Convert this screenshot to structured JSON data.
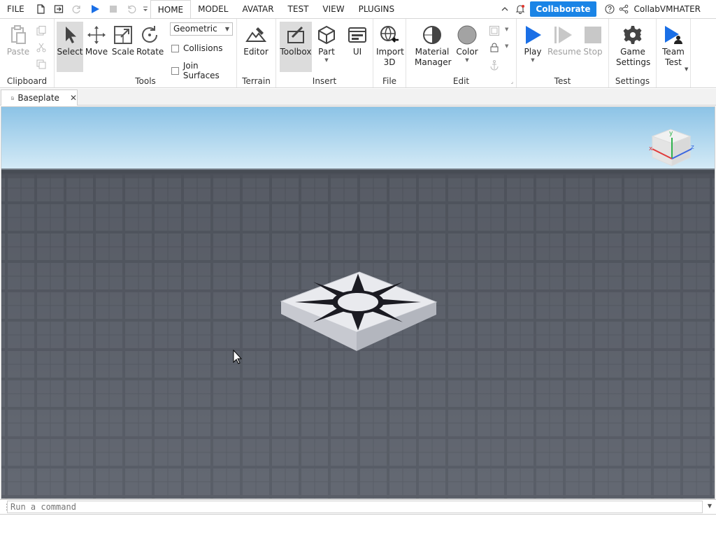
{
  "menubar": {
    "menus": [
      "FILE",
      "HOME",
      "MODEL",
      "AVATAR",
      "TEST",
      "VIEW",
      "PLUGINS"
    ],
    "active_menu": "HOME",
    "collaborate_label": "Collaborate",
    "username": "CollabVMHATER"
  },
  "ribbon": {
    "clipboard": {
      "paste_label": "Paste",
      "group_label": "Clipboard"
    },
    "tools": {
      "select_label": "Select",
      "move_label": "Move",
      "scale_label": "Scale",
      "rotate_label": "Rotate",
      "mode_value": "Geometric",
      "collisions_label": "Collisions",
      "join_surfaces_label": "Join Surfaces",
      "group_label": "Tools"
    },
    "terrain": {
      "editor_label": "Editor",
      "group_label": "Terrain"
    },
    "insert": {
      "toolbox_label": "Toolbox",
      "part_label": "Part",
      "ui_label": "UI",
      "group_label": "Insert"
    },
    "file": {
      "import3d_label_1": "Import",
      "import3d_label_2": "3D",
      "group_label": "File"
    },
    "edit": {
      "material_label_1": "Material",
      "material_label_2": "Manager",
      "color_label": "Color",
      "group_label": "Edit"
    },
    "test": {
      "play_label": "Play",
      "resume_label": "Resume",
      "stop_label": "Stop",
      "group_label": "Test"
    },
    "settings": {
      "game_label_1": "Game",
      "game_label_2": "Settings",
      "group_label": "Settings"
    },
    "team": {
      "team_label_1": "Team",
      "team_label_2": "Test"
    }
  },
  "tabs": {
    "doc_tab_label": "Baseplate",
    "close_glyph": "✕"
  },
  "viewport": {
    "sky_top": "#8cc3e6",
    "sky_bottom": "#d7ecf7",
    "ground": "#4a4e58"
  },
  "command": {
    "placeholder": "Run a command"
  },
  "colors": {
    "accent": "#1a84e6",
    "play": "#1a6fe6"
  }
}
